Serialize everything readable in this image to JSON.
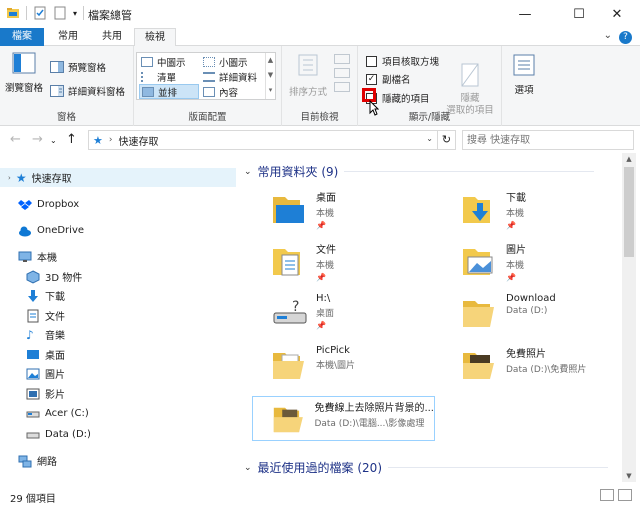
{
  "window": {
    "title": "檔案總管",
    "minimize": "—",
    "maximize": "☐",
    "close": "✕"
  },
  "ribbon_tabs": [
    "檔案",
    "常用",
    "共用",
    "檢視"
  ],
  "active_tab": "檢視",
  "ribbon": {
    "panes": {
      "nav_pane": "瀏覽窗格",
      "preview_pane": "預覽窗格",
      "details_pane": "詳細資料窗格",
      "label": "窗格"
    },
    "layout": {
      "items": [
        "中圖示",
        "小圖示",
        "清單",
        "詳細資料",
        "並排",
        "內容"
      ],
      "selected": "並排",
      "label": "版面配置"
    },
    "current_view": {
      "sort": "排序方式",
      "label": "目前檢視"
    },
    "show_hide": {
      "item_checkboxes": "項目核取方塊",
      "file_extensions": "副檔名",
      "hidden_items": "隱藏的項目",
      "hide_selected": "隱藏\n選取的項目",
      "label": "顯示/隱藏",
      "item_checkboxes_checked": false,
      "file_extensions_checked": true,
      "hidden_items_checked": false
    },
    "options": "選項"
  },
  "address": {
    "path": "快速存取",
    "search_placeholder": "搜尋 快速存取"
  },
  "nav_pane": {
    "items": [
      {
        "label": "快速存取",
        "icon": "star-icon"
      },
      {
        "label": "Dropbox",
        "icon": "dropbox-icon"
      },
      {
        "label": "OneDrive",
        "icon": "cloud-icon"
      },
      {
        "label": "本機",
        "icon": "computer-icon"
      },
      {
        "label": "3D 物件",
        "icon": "cube-icon"
      },
      {
        "label": "下載",
        "icon": "download-icon"
      },
      {
        "label": "文件",
        "icon": "document-icon"
      },
      {
        "label": "音樂",
        "icon": "music-icon"
      },
      {
        "label": "桌面",
        "icon": "desktop-icon"
      },
      {
        "label": "圖片",
        "icon": "pictures-icon"
      },
      {
        "label": "影片",
        "icon": "video-icon"
      },
      {
        "label": "Acer (C:)",
        "icon": "drive-icon"
      },
      {
        "label": "Data (D:)",
        "icon": "drive-icon"
      },
      {
        "label": "網路",
        "icon": "network-icon"
      }
    ]
  },
  "content": {
    "frequent_header": "常用資料夾 (9)",
    "recent_header": "最近使用過的檔案 (20)",
    "tiles": [
      {
        "name": "桌面",
        "sub": "本機",
        "pinned": true
      },
      {
        "name": "下載",
        "sub": "本機",
        "pinned": true
      },
      {
        "name": "文件",
        "sub": "本機",
        "pinned": true
      },
      {
        "name": "圖片",
        "sub": "本機",
        "pinned": true
      },
      {
        "name": "H:\\",
        "sub": "桌面",
        "pinned": true
      },
      {
        "name": "Download",
        "sub": "Data (D:)",
        "pinned": false
      },
      {
        "name": "PicPick",
        "sub": "本機\\圖片",
        "pinned": false
      },
      {
        "name": "免費照片",
        "sub": "Data (D:)\\免費照片",
        "pinned": false
      },
      {
        "name": "免費線上去除照片背景的...",
        "sub": "Data (D:)\\電腦...\\影像處理",
        "pinned": false
      }
    ]
  },
  "status": {
    "count": "29 個項目"
  },
  "colors": {
    "accent": "#1979ca",
    "folder": "#f2c94c",
    "highlight": "#e00000"
  }
}
